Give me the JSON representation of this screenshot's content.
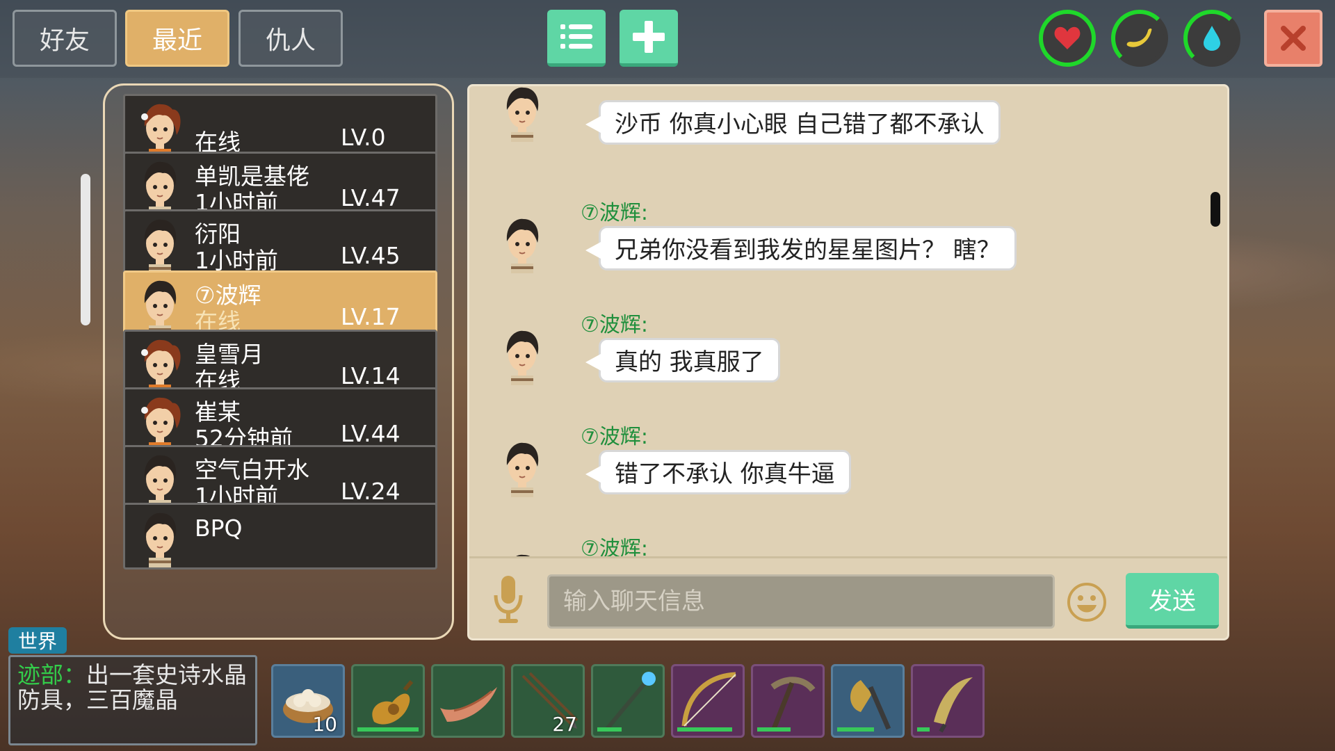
{
  "tabs": [
    {
      "label": "好友",
      "active": false
    },
    {
      "label": "最近",
      "active": true
    },
    {
      "label": "仇人",
      "active": false
    }
  ],
  "top_icons": [
    "list-icon",
    "plus-icon"
  ],
  "status_icons": [
    {
      "name": "heart-icon",
      "color": "#e0363e"
    },
    {
      "name": "banana-icon",
      "color": "#e8c93a"
    },
    {
      "name": "water-drop-icon",
      "color": "#2ed0e4"
    }
  ],
  "close_icon": "close-icon",
  "friends": [
    {
      "name": "",
      "status": "在线",
      "level": "LV.0",
      "avatar": "female",
      "selected": false
    },
    {
      "name": "单凯是基佬",
      "status": "1小时前",
      "level": "LV.47",
      "avatar": "male",
      "selected": false
    },
    {
      "name": "衍阳",
      "status": "1小时前",
      "level": "LV.45",
      "avatar": "male",
      "selected": false
    },
    {
      "name": "⑦波辉",
      "status": "在线",
      "level": "LV.17",
      "avatar": "male",
      "selected": true
    },
    {
      "name": "皇雪月",
      "status": "在线",
      "level": "LV.14",
      "avatar": "female",
      "selected": false
    },
    {
      "name": "崔某",
      "status": "52分钟前",
      "level": "LV.44",
      "avatar": "female",
      "selected": false
    },
    {
      "name": "空气白开水",
      "status": "1小时前",
      "level": "LV.24",
      "avatar": "male",
      "selected": false
    },
    {
      "name": "BPQ",
      "status": "",
      "level": "",
      "avatar": "male",
      "selected": false
    }
  ],
  "chat": {
    "messages": [
      {
        "sender": "",
        "text": "沙币 你真小心眼 自己错了都不承认"
      },
      {
        "sender": "⑦波辉:",
        "text": "兄弟你没看到我发的星星图片？ 瞎？"
      },
      {
        "sender": "⑦波辉:",
        "text": "真的 我真服了"
      },
      {
        "sender": "⑦波辉:",
        "text": "错了不承认 你真牛逼"
      },
      {
        "sender": "⑦波辉:",
        "text": ""
      }
    ],
    "input_placeholder": "输入聊天信息",
    "send_label": "发送"
  },
  "world": {
    "tag": "世界",
    "sender": "迹部：",
    "text": "出一套史诗水晶防具，三百魔晶"
  },
  "hotbar": [
    {
      "item": "dumpling-basket-icon",
      "count": "10",
      "bg": "blue",
      "durability": null
    },
    {
      "item": "gourd-flask-icon",
      "count": "",
      "bg": "green",
      "durability": 1.0
    },
    {
      "item": "boat-icon",
      "count": "",
      "bg": "green",
      "durability": null
    },
    {
      "item": "arrows-icon",
      "count": "27",
      "bg": "green",
      "durability": null
    },
    {
      "item": "spear-icon",
      "count": "",
      "bg": "green",
      "durability": 0.4
    },
    {
      "item": "bow-icon",
      "count": "",
      "bg": "purple",
      "durability": 0.9
    },
    {
      "item": "pickaxe-icon",
      "count": "",
      "bg": "purple",
      "durability": 0.55
    },
    {
      "item": "axe-icon",
      "count": "",
      "bg": "blue",
      "durability": 0.6
    },
    {
      "item": "sickle-icon",
      "count": "",
      "bg": "purple",
      "durability": 0.2
    }
  ]
}
